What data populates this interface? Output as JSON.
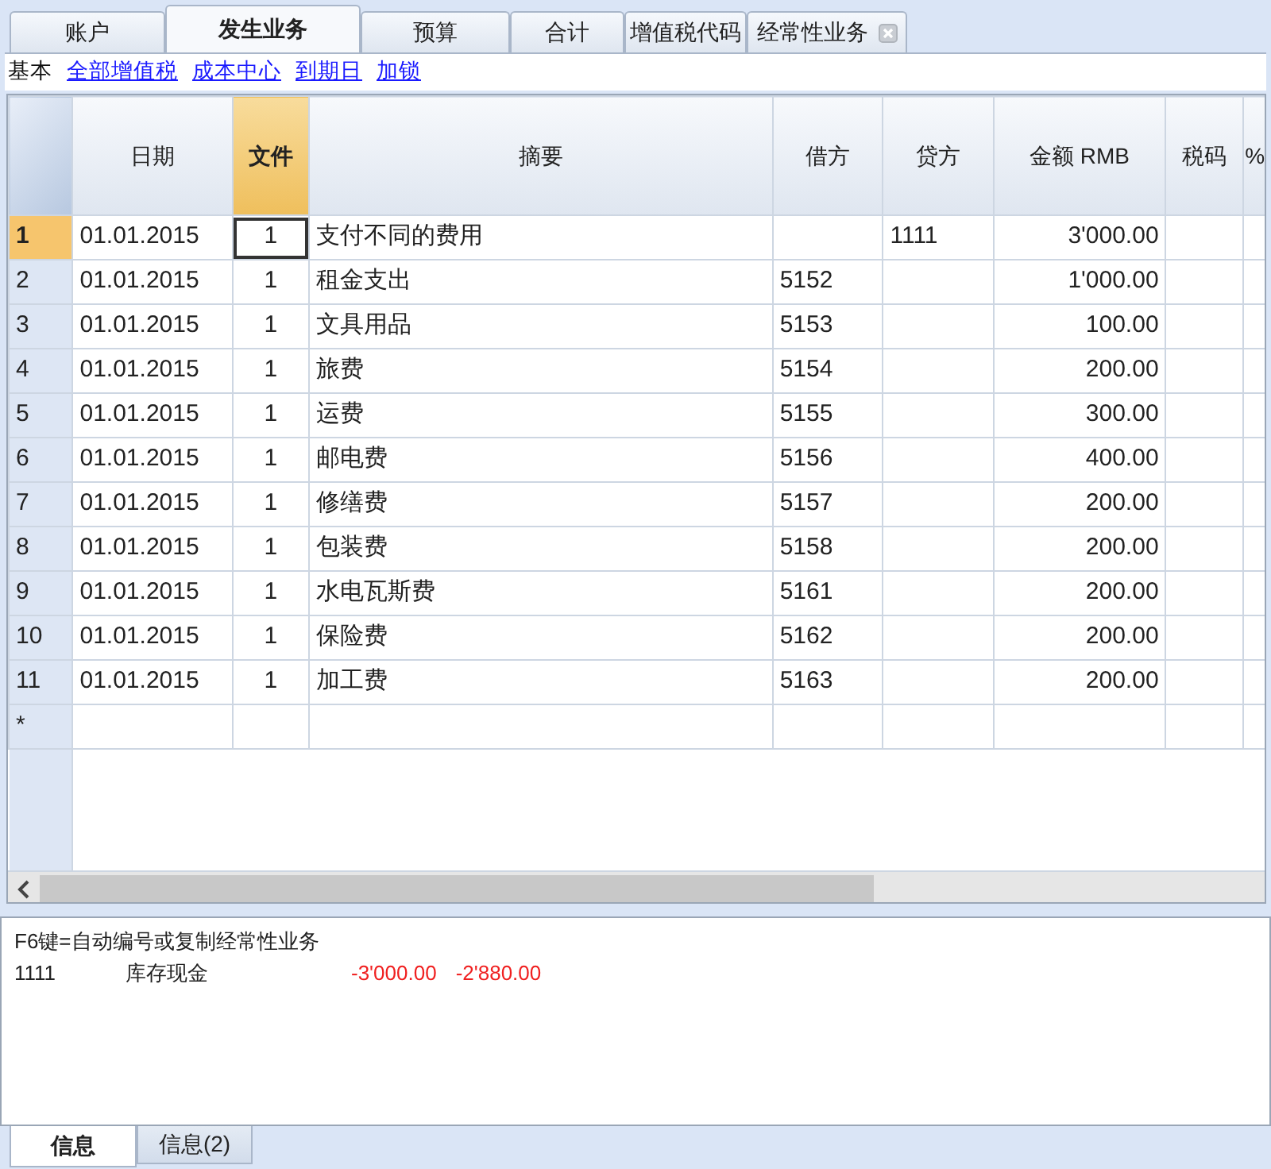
{
  "tabs": [
    {
      "label": "账户",
      "selected": false,
      "closable": false
    },
    {
      "label": "发生业务",
      "selected": true,
      "closable": false
    },
    {
      "label": "预算",
      "selected": false,
      "closable": false
    },
    {
      "label": "合计",
      "selected": false,
      "closable": false
    },
    {
      "label": "增值税代码",
      "selected": false,
      "closable": false
    },
    {
      "label": "经常性业务",
      "selected": false,
      "closable": true
    }
  ],
  "views": [
    {
      "label": "基本",
      "selected": true
    },
    {
      "label": "全部增值税",
      "selected": false
    },
    {
      "label": "成本中心",
      "selected": false
    },
    {
      "label": "到期日",
      "selected": false
    },
    {
      "label": "加锁",
      "selected": false
    }
  ],
  "table": {
    "columns": [
      {
        "label": "日期",
        "kind": "date",
        "selected": false
      },
      {
        "label": "文件",
        "kind": "doc",
        "selected": true
      },
      {
        "label": "摘要",
        "kind": "text",
        "selected": false
      },
      {
        "label": "借方",
        "kind": "account",
        "selected": false
      },
      {
        "label": "贷方",
        "kind": "account",
        "selected": false
      },
      {
        "label": "金额 RMB",
        "kind": "amount",
        "selected": false
      },
      {
        "label": "税码",
        "kind": "code",
        "selected": false
      },
      {
        "label": "%",
        "kind": "percent",
        "selected": false
      }
    ],
    "rows": [
      {
        "number": "1",
        "selected": true,
        "cells": [
          "01.01.2015",
          "1",
          "支付不同的费用",
          "",
          "1111",
          "3'000.00",
          "",
          ""
        ]
      },
      {
        "number": "2",
        "selected": false,
        "cells": [
          "01.01.2015",
          "1",
          "租金支出",
          "5152",
          "",
          "1'000.00",
          "",
          ""
        ]
      },
      {
        "number": "3",
        "selected": false,
        "cells": [
          "01.01.2015",
          "1",
          "文具用品",
          "5153",
          "",
          "100.00",
          "",
          ""
        ]
      },
      {
        "number": "4",
        "selected": false,
        "cells": [
          "01.01.2015",
          "1",
          "旅费",
          "5154",
          "",
          "200.00",
          "",
          ""
        ]
      },
      {
        "number": "5",
        "selected": false,
        "cells": [
          "01.01.2015",
          "1",
          "运费",
          "5155",
          "",
          "300.00",
          "",
          ""
        ]
      },
      {
        "number": "6",
        "selected": false,
        "cells": [
          "01.01.2015",
          "1",
          "邮电费",
          "5156",
          "",
          "400.00",
          "",
          ""
        ]
      },
      {
        "number": "7",
        "selected": false,
        "cells": [
          "01.01.2015",
          "1",
          "修缮费",
          "5157",
          "",
          "200.00",
          "",
          ""
        ]
      },
      {
        "number": "8",
        "selected": false,
        "cells": [
          "01.01.2015",
          "1",
          "包装费",
          "5158",
          "",
          "200.00",
          "",
          ""
        ]
      },
      {
        "number": "9",
        "selected": false,
        "cells": [
          "01.01.2015",
          "1",
          "水电瓦斯费",
          "5161",
          "",
          "200.00",
          "",
          ""
        ]
      },
      {
        "number": "10",
        "selected": false,
        "cells": [
          "01.01.2015",
          "1",
          "保险费",
          "5162",
          "",
          "200.00",
          "",
          ""
        ]
      },
      {
        "number": "11",
        "selected": false,
        "cells": [
          "01.01.2015",
          "1",
          "加工费",
          "5163",
          "",
          "200.00",
          "",
          ""
        ]
      },
      {
        "number": "*",
        "selected": false,
        "cells": [
          "",
          "",
          "",
          "",
          "",
          "",
          "",
          ""
        ]
      }
    ]
  },
  "info": {
    "hint": "F6键=自动编号或复制经常性业务",
    "account": {
      "number": "1111",
      "name": "库存现金",
      "amounts": [
        "-3'000.00",
        "-2'880.00"
      ]
    }
  },
  "bottom_tabs": [
    {
      "label": "信息",
      "selected": true
    },
    {
      "label": "信息(2)",
      "selected": false
    }
  ]
}
